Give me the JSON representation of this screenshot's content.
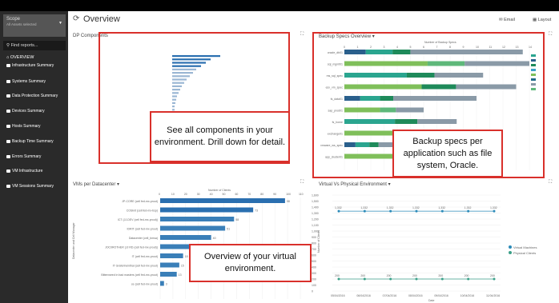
{
  "sidebar": {
    "scope_title": "Scope",
    "scope_sub": "All Assets selected",
    "find": "Find reports...",
    "overview": "OVERVIEW",
    "items": [
      {
        "label": "Infrastructure Summary"
      },
      {
        "label": "Systems Summary"
      },
      {
        "label": "Data Protection Summary"
      },
      {
        "label": "Devices Summary"
      },
      {
        "label": "Hosts Summary"
      },
      {
        "label": "Backup Time Summary"
      },
      {
        "label": "Errors Summary"
      },
      {
        "label": "VM Infrastructure"
      },
      {
        "label": "VM Sessions Summary"
      }
    ]
  },
  "header": {
    "title": "Overview",
    "email": "Email",
    "layout": "Layout"
  },
  "panels": {
    "dp": {
      "title": "DP Components",
      "callout": "See all components in your environment. Drill down for detail."
    },
    "backup": {
      "title": "Backup Specs Overview",
      "callout": "Backup specs per application such as file system, Oracle.",
      "axis_title": "Number of Backup Specs"
    },
    "vms": {
      "title": "VMs per Datacenter",
      "callout": "Overview of your virtual environment.",
      "axis_title": "Number of Clients",
      "yaxis": "Datacenter and Cell Manager"
    },
    "virt": {
      "title": "Virtual Vs Physical Environment",
      "legend": [
        "Virtual Machines",
        "Physical Clients"
      ],
      "yaxis": "Number of Clients",
      "xaxis": "Date"
    }
  },
  "chart_data": [
    {
      "type": "bar",
      "title": "VMs per Datacenter",
      "xlabel": "Number of Clients",
      "ylabel": "Datacenter and Cell Manager",
      "xlim": [
        0,
        110
      ],
      "ticks": [
        "0",
        "10",
        "20",
        "30",
        "40",
        "50",
        "60",
        "70",
        "80",
        "90",
        "100",
        "110"
      ],
      "categories": [
        "JP-CORE (cell fed-mx-prout)",
        "COSInit (cell fed-mx-bsp)",
        "ICT (JJ-DEV (cell fed-mx-prout))",
        "IDRIT (cell fed-mx-prout)",
        "Datacenter (cell_bmsa)",
        "JOC0ROTHER (JJ RD (cell fed-mx-prout))",
        "IT (cell fed-mx-prout)",
        "IT Grafenheinthal (cell fed-mx-prout)",
        "Bittenweed in bad masters (cell fed-mx-prout)",
        "ce (cell fed-mx-prout)"
      ],
      "values": [
        98,
        73,
        58,
        51,
        40,
        25,
        18,
        15,
        13,
        3
      ]
    },
    {
      "type": "line",
      "title": "Virtual Vs Physical Environment",
      "xlabel": "Date",
      "ylabel": "Number of Clients",
      "ylim": [
        0,
        1600
      ],
      "yticks": [
        0,
        100,
        200,
        300,
        400,
        500,
        600,
        700,
        800,
        900,
        1000,
        1100,
        1200,
        1300,
        1400,
        1500,
        1600
      ],
      "x": [
        "05/04/2016",
        "06/04/2016",
        "07/04/2016",
        "08/04/2016",
        "09/04/2016",
        "10/04/2016",
        "11/04/2016"
      ],
      "series": [
        {
          "name": "Virtual Machines",
          "values": [
            1332,
            1332,
            1332,
            1332,
            1332,
            1332,
            1332
          ]
        },
        {
          "name": "Physical Clients",
          "values": [
            200,
            200,
            200,
            200,
            200,
            200,
            200
          ]
        }
      ]
    },
    {
      "type": "bar",
      "title": "Backup Specs Overview",
      "xlabel": "Number of Backup Specs",
      "ticks": [
        "0",
        "1",
        "2",
        "3",
        "4",
        "5",
        "6",
        "7",
        "8",
        "9",
        "10",
        "11",
        "12",
        "13",
        "14"
      ],
      "categories": [
        "oracle_db01",
        "sql_mgmt01",
        "ms_sql_spec",
        "esx_vm_spec",
        "fs_data01",
        "sap_prod01",
        "fs_home",
        "exchange01",
        "vmware_ws_spec",
        "app_cluster01"
      ],
      "values": [
        13.5,
        14,
        10.5,
        13,
        10,
        6,
        8.5,
        9.5,
        7,
        11
      ]
    }
  ]
}
